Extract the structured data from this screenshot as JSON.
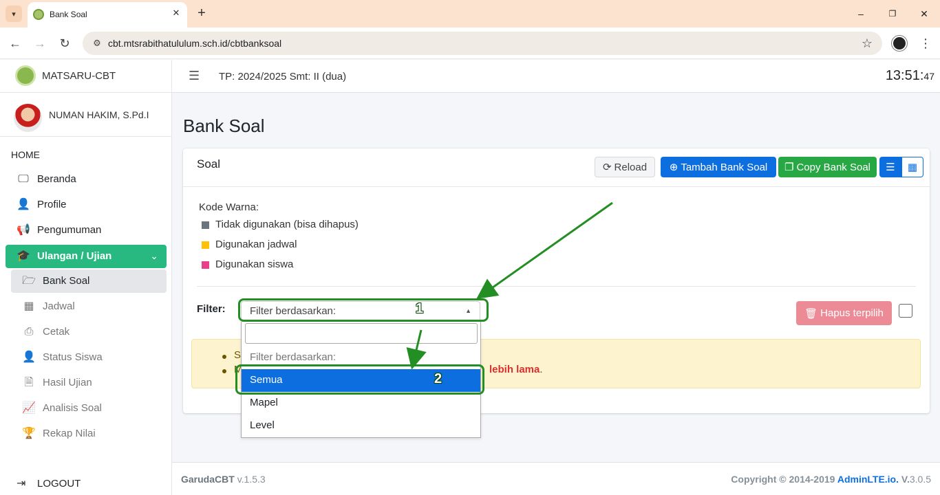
{
  "browser": {
    "tab_title": "Bank Soal",
    "tab_close": "✕",
    "new_tab": "+",
    "url": "cbt.mtsrabithatululum.sch.id/cbtbanksoal",
    "window_controls": {
      "minimize": "–",
      "maximize": "❐",
      "close": "✕"
    }
  },
  "sidebar": {
    "brand": "MATSARU-CBT",
    "user_name": "NUMAN HAKIM, S.Pd.I",
    "header": "HOME",
    "items": [
      {
        "label": "Beranda",
        "icon": "desktop-icon"
      },
      {
        "label": "Profile",
        "icon": "user-icon"
      },
      {
        "label": "Pengumuman",
        "icon": "megaphone-icon"
      },
      {
        "label": "Ulangan / Ujian",
        "icon": "graduate-icon",
        "active": true
      },
      {
        "label": "Bank Soal",
        "icon": "folder-open-icon",
        "selected": true
      },
      {
        "label": "Jadwal",
        "icon": "calendar-icon"
      },
      {
        "label": "Cetak",
        "icon": "printer-icon"
      },
      {
        "label": "Status Siswa",
        "icon": "user-clock-icon"
      },
      {
        "label": "Hasil Ujian",
        "icon": "file-icon"
      },
      {
        "label": "Analisis Soal",
        "icon": "chart-line-icon"
      },
      {
        "label": "Rekap Nilai",
        "icon": "trophy-icon"
      }
    ],
    "logout": "LOGOUT"
  },
  "topbar": {
    "tp_text": "TP: 2024/2025 Smt: II (dua)",
    "clock_hm": "13:51:",
    "clock_s": "47"
  },
  "page": {
    "title": "Bank Soal",
    "card_title": "Soal",
    "buttons": {
      "reload": "Reload",
      "tambah": "Tambah Bank Soal",
      "copy": "Copy Bank Soal",
      "hapus": "Hapus terpilih"
    },
    "kode_warna_label": "Kode Warna:",
    "legend": [
      {
        "label": "Tidak digunakan (bisa dihapus)",
        "color": "#6c757d"
      },
      {
        "label": "Digunakan jadwal",
        "color": "#ffc107"
      },
      {
        "label": "Digunakan siswa",
        "color": "#e83e8c"
      }
    ],
    "filter_label": "Filter:",
    "filter_select_value": "Filter berdasarkan:",
    "alert": {
      "line1_prefix": "Si",
      "line2_prefix": "M",
      "line2_bold": "lebih lama",
      "line2_end": "."
    }
  },
  "dropdown": {
    "search_value": "",
    "group_label": "Filter berdasarkan:",
    "options": [
      "Semua",
      "Mapel",
      "Level"
    ],
    "highlighted": "Semua"
  },
  "annotations": {
    "step1": "1",
    "step2": "2",
    "color": "#238e23"
  },
  "footer": {
    "app": "GarudaCBT",
    "version": "v.1.5.3",
    "copyright": "Copyright © 2014-2019",
    "brand": "AdminLTE.io.",
    "v_label": "V.",
    "v_num": "3.0.5"
  }
}
